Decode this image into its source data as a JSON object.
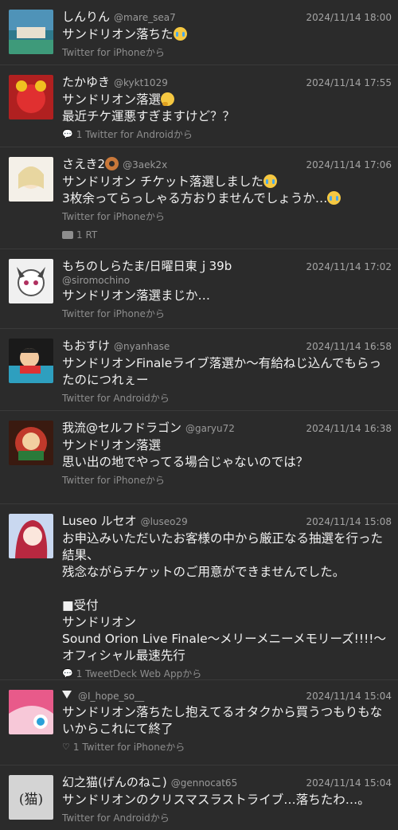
{
  "tweets": [
    {
      "name": "しんりん",
      "handle": "@mare_sea7",
      "time": "2024/11/14 18:00",
      "text": "サンドリオン落ちた",
      "emoji": "cry",
      "footer": "Twitter for iPhoneから"
    },
    {
      "name": "たかゆき",
      "handle": "@kykt1029",
      "time": "2024/11/14 17:55",
      "text_line1": "サンドリオン落選",
      "emoji": "think",
      "text_line2": "最近チケ運悪すぎますけど？？",
      "footer_icon": "reply-icon",
      "footer_count": "1",
      "footer": "Twitter for Androidから"
    },
    {
      "name": "さえき2",
      "name_emoji": "donut",
      "handle": "@3aek2x",
      "time": "2024/11/14 17:06",
      "text_line1": "サンドリオン チケット落選しました",
      "text_line2": "3枚余ってらっしゃる方おりませんでしょうか…",
      "footer": "Twitter for iPhoneから",
      "rt": "1 RT"
    },
    {
      "name": "もちのしらたま/日曜日東ｊ39b",
      "handle": "@siromochino",
      "time": "2024/11/14 17:02",
      "text": "サンドリオン落選まじか…",
      "footer": "Twitter for iPhoneから"
    },
    {
      "name": "もおすけ",
      "handle": "@nyanhase",
      "time": "2024/11/14 16:58",
      "text": "サンドリオンFinaleライブ落選か〜有給ねじ込んでもらったのにつれぇー",
      "footer": "Twitter for Androidから"
    },
    {
      "name": "我流@セルフドラゴン",
      "handle": "@garyu72",
      "time": "2024/11/14 16:38",
      "text": "サンドリオン落選\n思い出の地でやってる場合じゃないのでは？",
      "footer": "Twitter for iPhoneから"
    },
    {
      "name": "Luseo ルセオ",
      "handle": "@luseo29",
      "time": "2024/11/14 15:08",
      "text": "お申込みいただいたお客様の中から厳正なる抽選を行った結果、\n残念ながらチケットのご用意ができませんでした。\n\n■受付\nサンドリオン\nSound Orion Live Finale～メリーメニーメモリーズ!!!!～ オフィシャル最速先行",
      "footer_icon": "reply-icon",
      "footer_count": "1",
      "footer": "TweetDeck Web Appから"
    },
    {
      "name": "",
      "handle": "@I_hope_so__",
      "time": "2024/11/14 15:04",
      "text": "サンドリオン落ちたし抱えてるオタクから買うつもりもないからこれにて終了",
      "footer_icon": "heart-icon",
      "footer_count": "1",
      "footer": "Twitter for iPhoneから"
    },
    {
      "name": "幻之猫(げんのねこ)",
      "handle": "@gennocat65",
      "time": "2024/11/14 15:04",
      "text": "サンドリオンのクリスマスラストライブ…落ちたわ…。",
      "footer": "Twitter for Androidから",
      "avatar_text": "(猫)"
    }
  ],
  "icons": {
    "reply": "💬",
    "heart": "♡"
  }
}
